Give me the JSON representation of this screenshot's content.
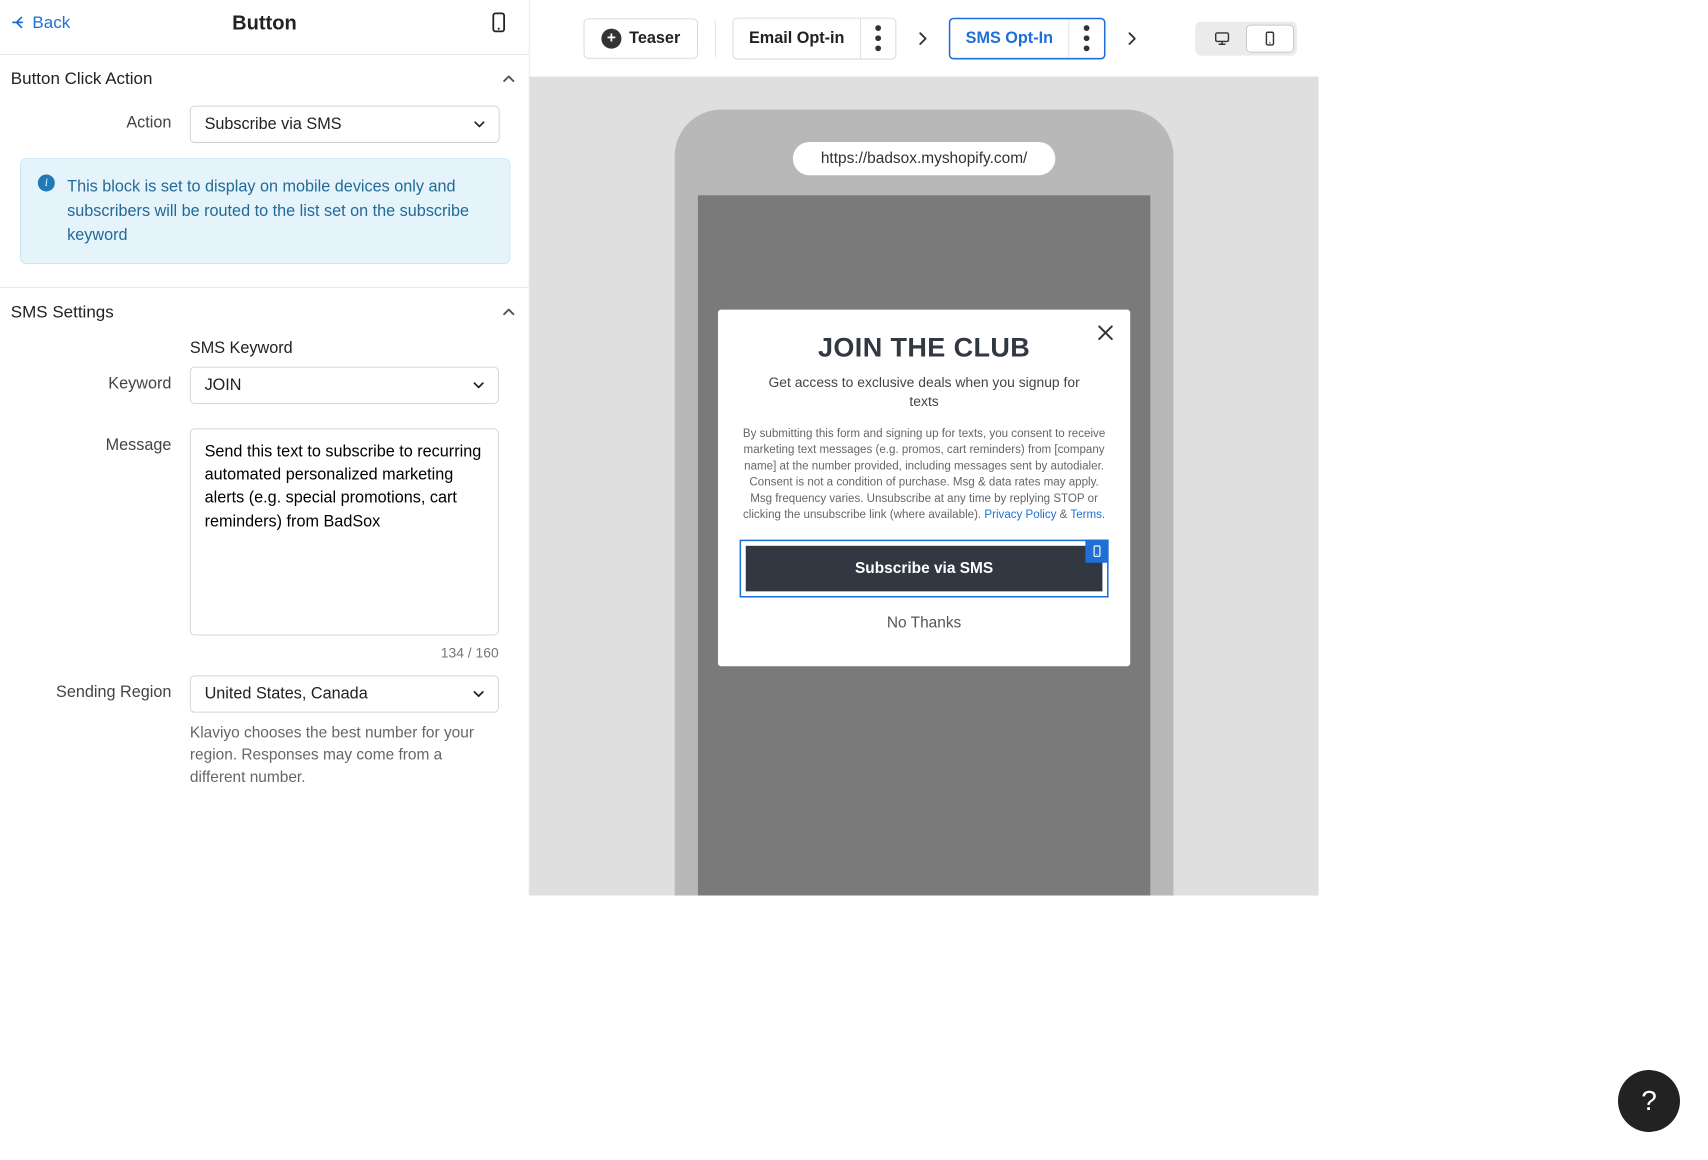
{
  "header": {
    "back_label": "Back",
    "title": "Button"
  },
  "sections": {
    "click_action": {
      "title": "Button Click Action",
      "action_label": "Action",
      "action_value": "Subscribe via SMS",
      "info_text": "This block is set to display on mobile devices only and subscribers will be routed to the list set on the subscribe keyword"
    },
    "sms_settings": {
      "title": "SMS Settings",
      "keyword_label": "Keyword",
      "keyword_sublabel": "SMS Keyword",
      "keyword_value": "JOIN",
      "message_label": "Message",
      "message_value": "Send this text to subscribe to recurring automated personalized marketing alerts (e.g. special promotions, cart reminders) from BadSox",
      "char_count": "134 / 160",
      "region_label": "Sending Region",
      "region_value": "United States, Canada",
      "region_helper": "Klaviyo chooses the best number for your region. Responses may come from a different number."
    }
  },
  "topbar": {
    "teaser_label": "Teaser",
    "steps": [
      {
        "label": "Email Opt-in",
        "active": false
      },
      {
        "label": "SMS Opt-In",
        "active": true
      }
    ]
  },
  "preview": {
    "url": "https://badsox.myshopify.com/",
    "popup": {
      "headline": "JOIN THE CLUB",
      "subtext": "Get access to exclusive deals when you signup for texts",
      "legal_pre": "By submitting this form and signing up for texts, you consent to receive marketing text messages (e.g. promos, cart reminders) from [company name] at the number provided, including messages sent by autodialer. Consent is not a condition of purchase. Msg & data rates may apply. Msg frequency varies. Unsubscribe at any time by replying STOP or clicking the unsubscribe link (where available). ",
      "privacy_link": "Privacy Policy",
      "amp": " & ",
      "terms_link": "Terms",
      "period": ".",
      "subscribe_label": "Subscribe via SMS",
      "no_thanks": "No Thanks"
    }
  },
  "help": "?"
}
